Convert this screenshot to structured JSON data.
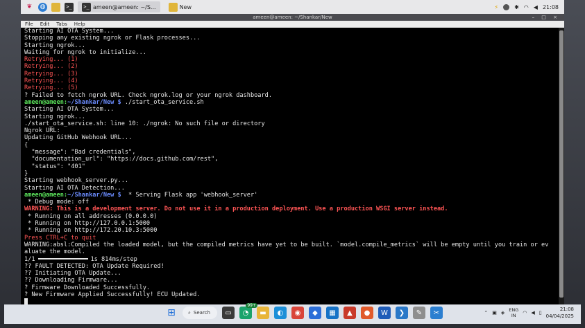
{
  "pi_panel": {
    "tasks": [
      {
        "label": "ameen@ameen: ~/S...",
        "active": true
      },
      {
        "label": "New",
        "active": false
      }
    ],
    "time": "21:08"
  },
  "terminal_window": {
    "title": "ameen@ameen: ~/Shankar/New",
    "window_controls": "– □ ×",
    "menu": [
      "File",
      "Edit",
      "Tabs",
      "Help"
    ]
  },
  "terminal": {
    "lines": [
      {
        "text": "Starting AI OTA System..."
      },
      {
        "text": "Stopping any existing ngrok or Flask processes..."
      },
      {
        "text": "Starting ngrok..."
      },
      {
        "text": "Waiting for ngrok to initialize..."
      },
      {
        "text": "Retrying... (1)",
        "style": "red"
      },
      {
        "text": "Retrying... (2)",
        "style": "red"
      },
      {
        "text": "Retrying... (3)",
        "style": "red"
      },
      {
        "text": "Retrying... (4)",
        "style": "red"
      },
      {
        "text": "Retrying... (5)",
        "style": "red"
      },
      {
        "text": "? Failed to fetch ngrok URL. Check ngrok.log or your ngrok dashboard."
      },
      {
        "user": "ameen@ameen",
        "path": "~/Shankar/New $",
        "text": " ./start_ota_service.sh"
      },
      {
        "text": "Starting AI OTA System..."
      },
      {
        "text": "Starting ngrok..."
      },
      {
        "text": "./start_ota_service.sh: line 10: ./ngrok: No such file or directory"
      },
      {
        "text": "Ngrok URL:"
      },
      {
        "text": "Updating GitHub Webhook URL..."
      },
      {
        "text": "{"
      },
      {
        "text": "  \"message\": \"Bad credentials\","
      },
      {
        "text": "  \"documentation_url\": \"https://docs.github.com/rest\","
      },
      {
        "text": "  \"status\": \"401\""
      },
      {
        "text": "}"
      },
      {
        "text": "Starting webhook_server.py..."
      },
      {
        "text": "Starting AI OTA Detection..."
      },
      {
        "user": "ameen@ameen",
        "path": "~/Shankar/New $",
        "text": "  * Serving Flask app 'webhook_server'"
      },
      {
        "text": " * Debug mode: off"
      },
      {
        "text": "WARNING: This is a development server. Do not use it in a production deployment. Use a production WSGI server instead.",
        "style": "warn"
      },
      {
        "text": " * Running on all addresses (0.0.0.0)"
      },
      {
        "text": " * Running on http://127.0.0.1:5000"
      },
      {
        "text": " * Running on http://172.20.10.3:5000"
      },
      {
        "text": "Press CTRL+C to quit",
        "style": "red"
      },
      {
        "text": "WARNING:absl:Compiled the loaded model, but the compiled metrics have yet to be built. `model.compile_metrics` will be empty until you train or ev"
      },
      {
        "text": "aluate the model."
      },
      {
        "text": "1/1",
        "bar": true,
        "after": "1s 814ms/step"
      },
      {
        "text": "?? FAULT DETECTED: OTA Update Required!"
      },
      {
        "text": "?? Initiating OTA Update..."
      },
      {
        "text": "?? Downloading Firmware..."
      },
      {
        "text": "? Firmware Downloaded Successfully."
      },
      {
        "text": "? New Firmware Applied Successfully! ECU Updated."
      },
      {
        "text": "",
        "cursor": true
      }
    ]
  },
  "windows_taskbar": {
    "search_label": "Search",
    "badge": "99+",
    "lang": [
      "ENG",
      "IN"
    ],
    "time": "21:08",
    "date": "04/04/2025"
  }
}
